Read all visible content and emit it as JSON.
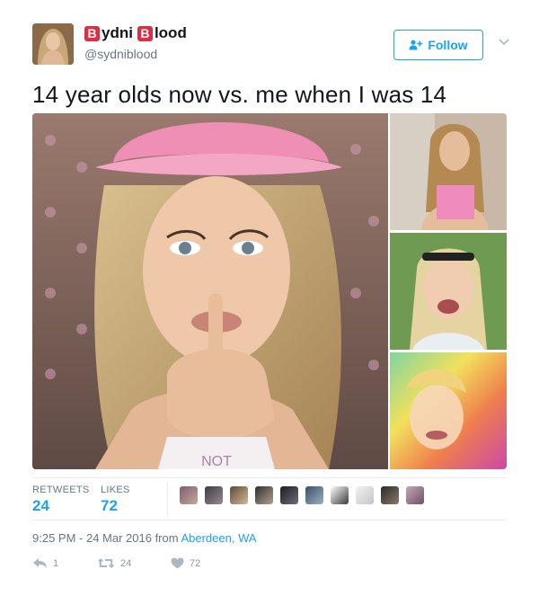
{
  "user": {
    "name_emoji_1": "B",
    "name_part_1": "ydni",
    "name_emoji_2": "B",
    "name_part_2": "lood",
    "handle": "@sydniblood"
  },
  "follow_button": {
    "label": "Follow"
  },
  "tweet": {
    "text": "14 year olds now vs. me when I was 14"
  },
  "media": {
    "main_image_caption": "NOT"
  },
  "stats": {
    "retweets_label": "RETWEETS",
    "retweets_value": "24",
    "likes_label": "LIKES",
    "likes_value": "72",
    "liker_count": 10
  },
  "meta": {
    "time": "9:25 PM - 24 Mar 2016 from ",
    "location": "Aberdeen, WA"
  },
  "actions": {
    "reply_count": "1",
    "retweet_count": "24",
    "like_count": "72"
  },
  "colors": {
    "accent": "#1da1f2",
    "muted": "#657786",
    "emoji_red": "#dd2e44"
  }
}
